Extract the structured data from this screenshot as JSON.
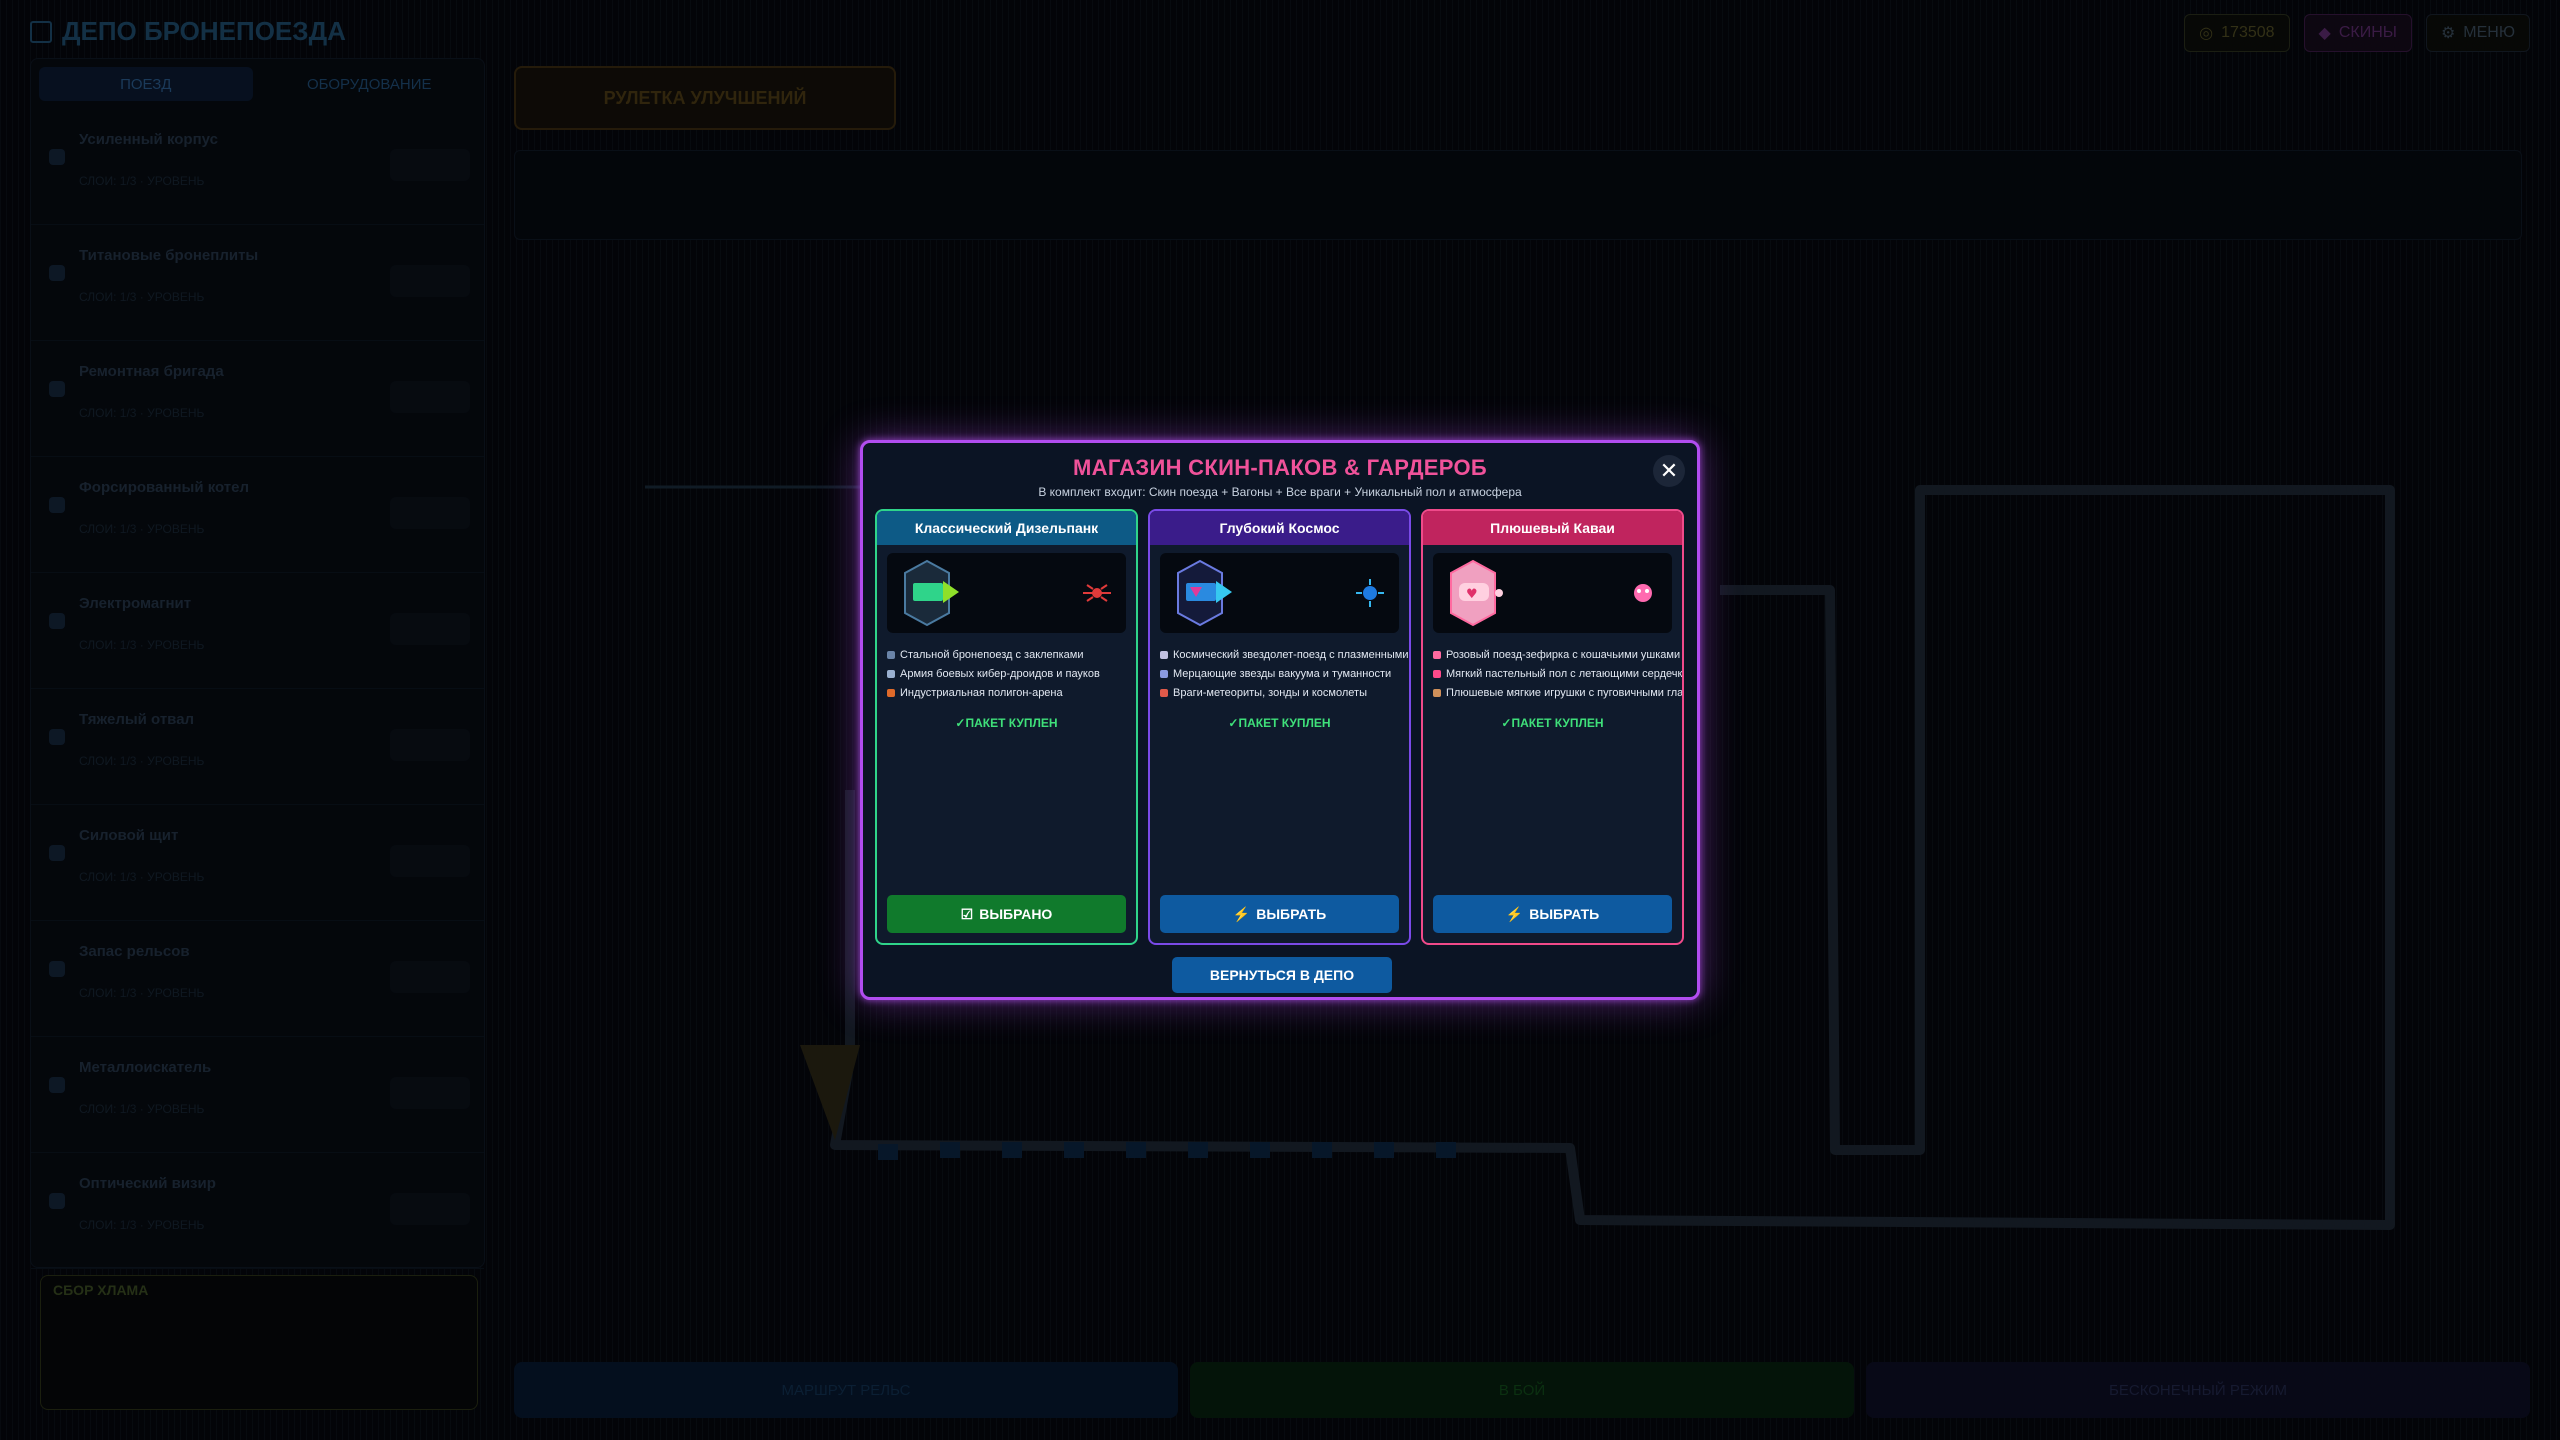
{
  "header": {
    "title": "ДЕПО БРОНЕПОЕЗДА",
    "currency": "173508",
    "skins_label": "СКИНЫ",
    "menu_label": "МЕНЮ"
  },
  "sidebar": {
    "tabs": [
      {
        "label": "ПОЕЗД"
      },
      {
        "label": "ОБОРУДОВАНИЕ"
      }
    ],
    "upgrades": [
      {
        "name": "Усиленный корпус",
        "desc": "СЛОИ: 1/3 · УРОВЕНЬ"
      },
      {
        "name": "Титановые бронеплиты",
        "desc": "СЛОИ: 1/3 · УРОВЕНЬ"
      },
      {
        "name": "Ремонтная бригада",
        "desc": "СЛОИ: 1/3 · УРОВЕНЬ"
      },
      {
        "name": "Форсированный котел",
        "desc": "СЛОИ: 1/3 · УРОВЕНЬ"
      },
      {
        "name": "Электромагнит",
        "desc": "СЛОИ: 1/3 · УРОВЕНЬ"
      },
      {
        "name": "Тяжелый отвал",
        "desc": "СЛОИ: 1/3 · УРОВЕНЬ"
      },
      {
        "name": "Силовой щит",
        "desc": "СЛОИ: 1/3 · УРОВЕНЬ"
      },
      {
        "name": "Запас рельсов",
        "desc": "СЛОИ: 1/3 · УРОВЕНЬ"
      },
      {
        "name": "Металлоискатель",
        "desc": "СЛОИ: 1/3 · УРОВЕНЬ"
      },
      {
        "name": "Оптический визир",
        "desc": "СЛОИ: 1/3 · УРОВЕНЬ"
      }
    ]
  },
  "scrap": {
    "title": "СБОР ХЛАМА"
  },
  "roulette": {
    "label": "РУЛЕТКА УЛУЧШЕНИЙ"
  },
  "bottom": {
    "route": "МАРШРУТ РЕЛЬС",
    "start": "В БОЙ",
    "endless": "БЕСКОНЕЧНЫЙ РЕЖИМ"
  },
  "modal": {
    "title": "МАГАЗИН СКИН-ПАКОВ & ГАРДЕРОБ",
    "subtitle": "В комплект входит: Скин поезда + Вагоны + Все враги + Уникальный пол и атмосфера",
    "close": "✕",
    "back_label": "ВЕРНУТЬСЯ В ДЕПО",
    "packs": [
      {
        "name": "Классический Дизельпанк",
        "features": [
          "Стальной бронепоезд с заклепками",
          "Армия боевых кибер-дроидов и пауков",
          "Индустриальная полигон-арена"
        ],
        "status": "✓ПАКЕТ КУПЛЕН",
        "button": "ВЫБРАНО",
        "accent": "#2fd48a"
      },
      {
        "name": "Глубокий Космос",
        "features": [
          "Космический звездолет-поезд с плазменными соплами",
          "Мерцающие звезды вакуума и туманности",
          "Враги-метеориты, зонды и космолеты"
        ],
        "status": "✓ПАКЕТ КУПЛЕН",
        "button": "ВЫБРАТЬ",
        "accent": "#7a4ae8"
      },
      {
        "name": "Плюшевый Каваи",
        "features": [
          "Розовый поезд-зефирка с кошачьими ушками",
          "Мягкий пастельный пол с летающими сердечками",
          "Плюшевые мягкие игрушки с пуговичными глазками"
        ],
        "status": "✓ПАКЕТ КУПЛЕН",
        "button": "ВЫБРАТЬ",
        "accent": "#f04a8a"
      }
    ]
  }
}
